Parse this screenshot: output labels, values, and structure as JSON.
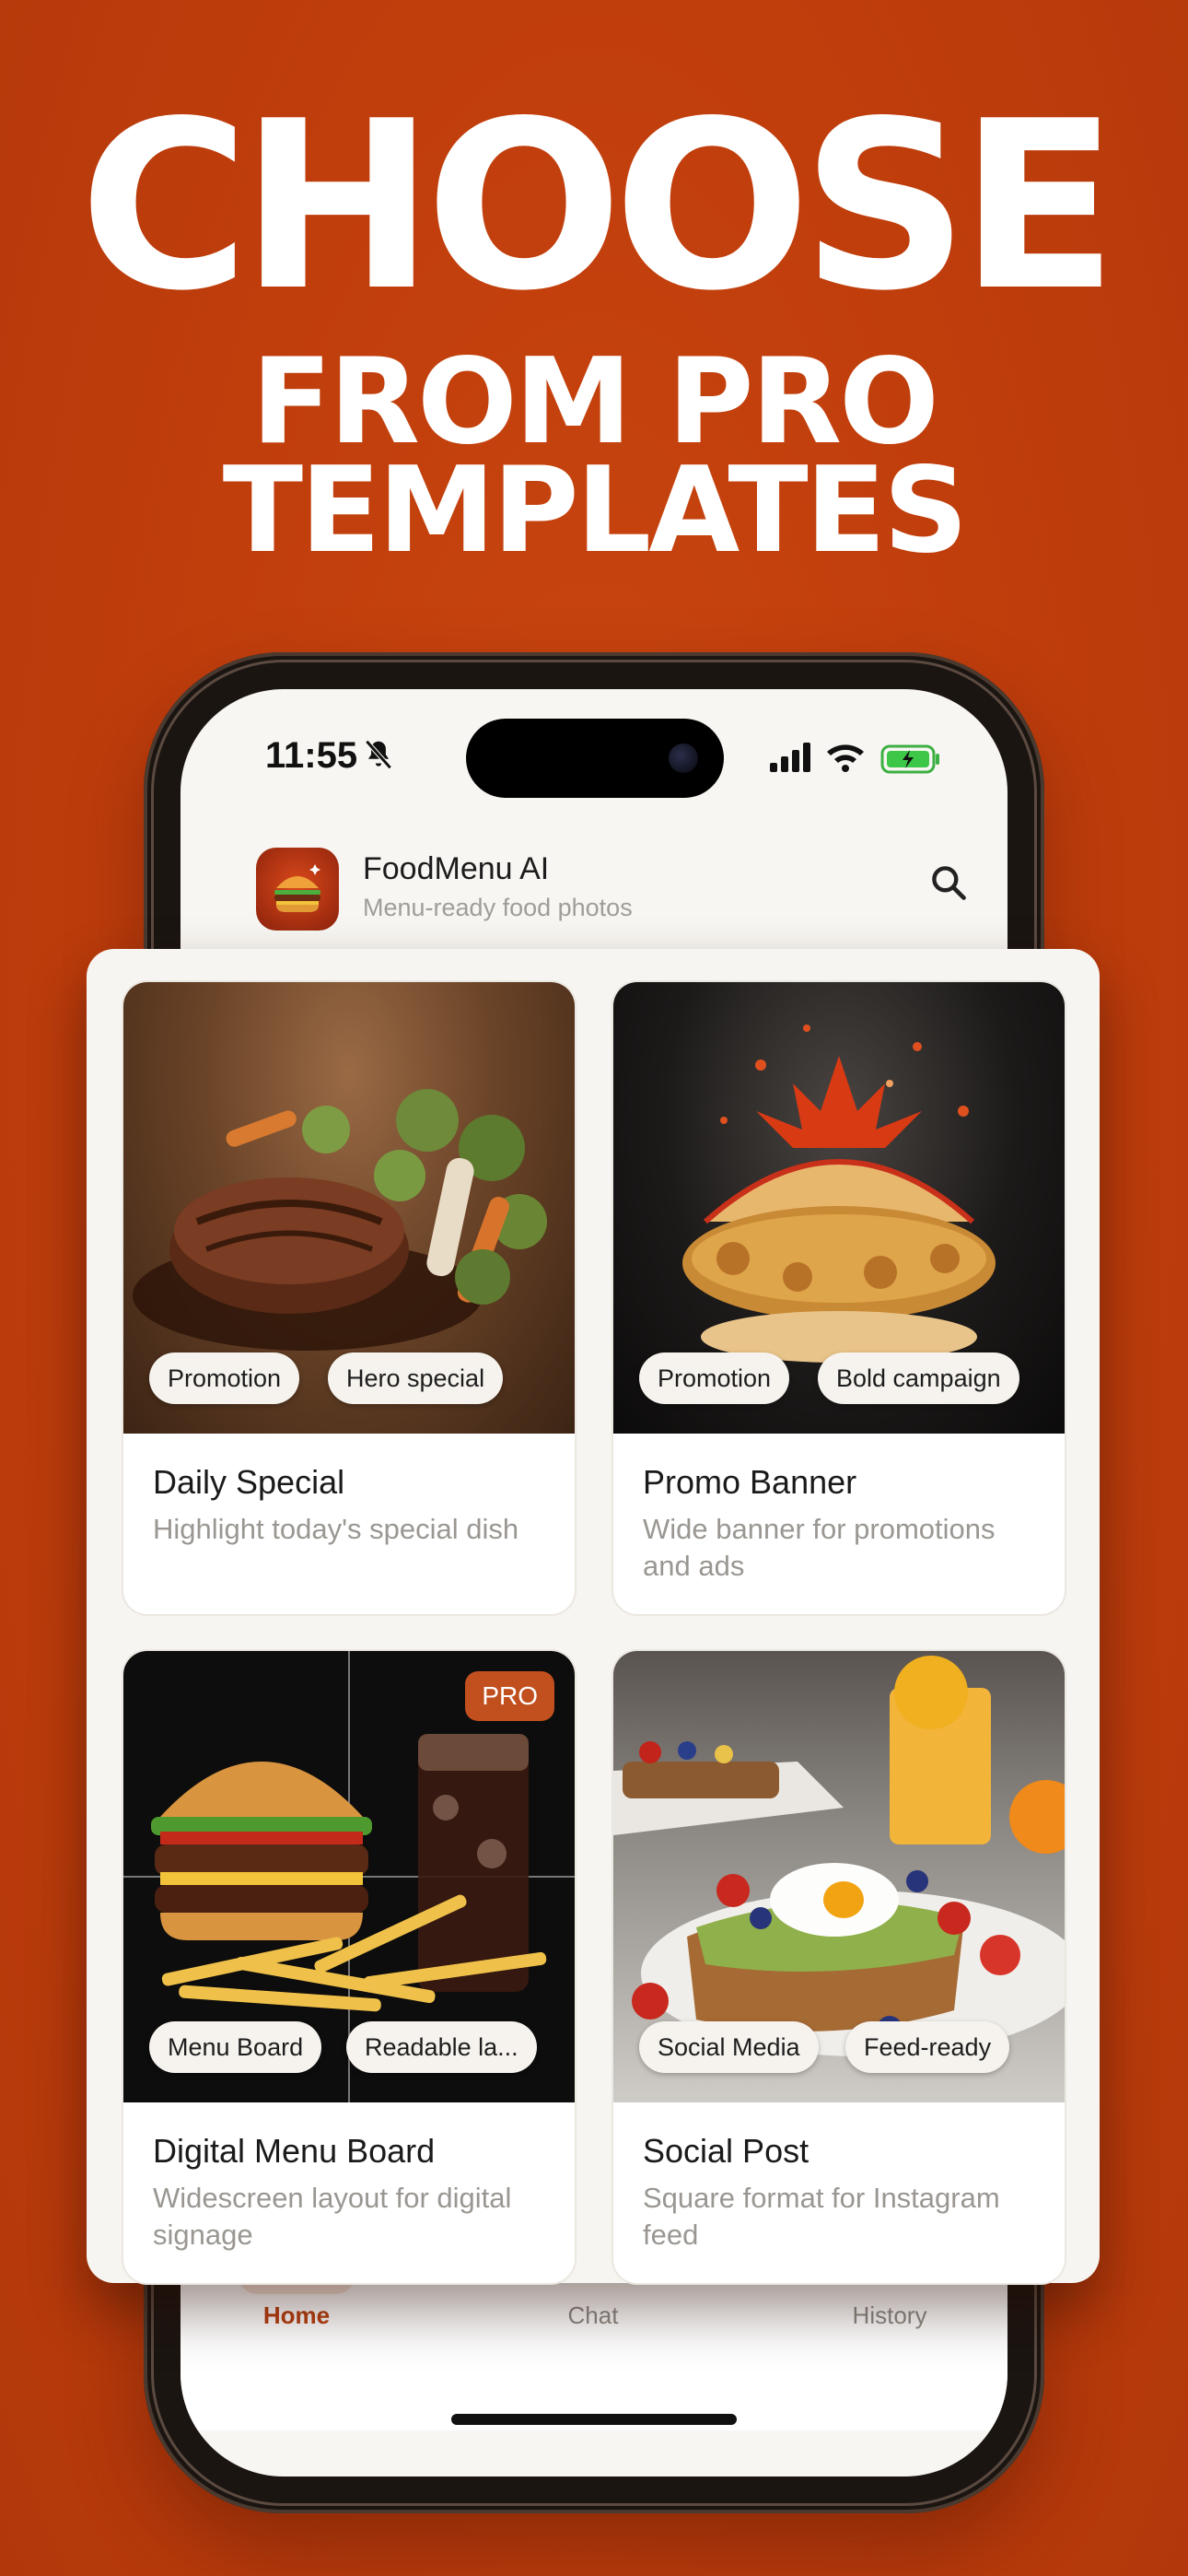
{
  "promo": {
    "line1": "CHOOSE",
    "line2": "FROM PRO",
    "line3": "TEMPLATES"
  },
  "status_bar": {
    "time": "11:55"
  },
  "app": {
    "name": "FoodMenu AI",
    "tagline": "Menu-ready food photos"
  },
  "templates": [
    {
      "title": "Daily Special",
      "description": "Highlight today's special dish",
      "tags": [
        "Promotion",
        "Hero special"
      ],
      "pro": ""
    },
    {
      "title": "Promo Banner",
      "description": "Wide banner for promotions and ads",
      "tags": [
        "Promotion",
        "Bold campaign"
      ],
      "pro": ""
    },
    {
      "title": "Digital Menu Board",
      "description": "Widescreen layout for digital signage",
      "tags": [
        "Menu Board",
        "Readable la..."
      ],
      "pro": "PRO"
    },
    {
      "title": "Social Post",
      "description": "Square format for Instagram feed",
      "tags": [
        "Social Media",
        "Feed-ready"
      ],
      "pro": ""
    }
  ],
  "tabs": [
    {
      "label": "Home",
      "icon": "home-icon",
      "active": true
    },
    {
      "label": "Chat",
      "icon": "chat-icon",
      "active": false
    },
    {
      "label": "History",
      "icon": "history-icon",
      "active": false
    }
  ],
  "colors": {
    "background": "#c2400f",
    "accent": "#b84112",
    "pro_badge": "#c2501f"
  }
}
